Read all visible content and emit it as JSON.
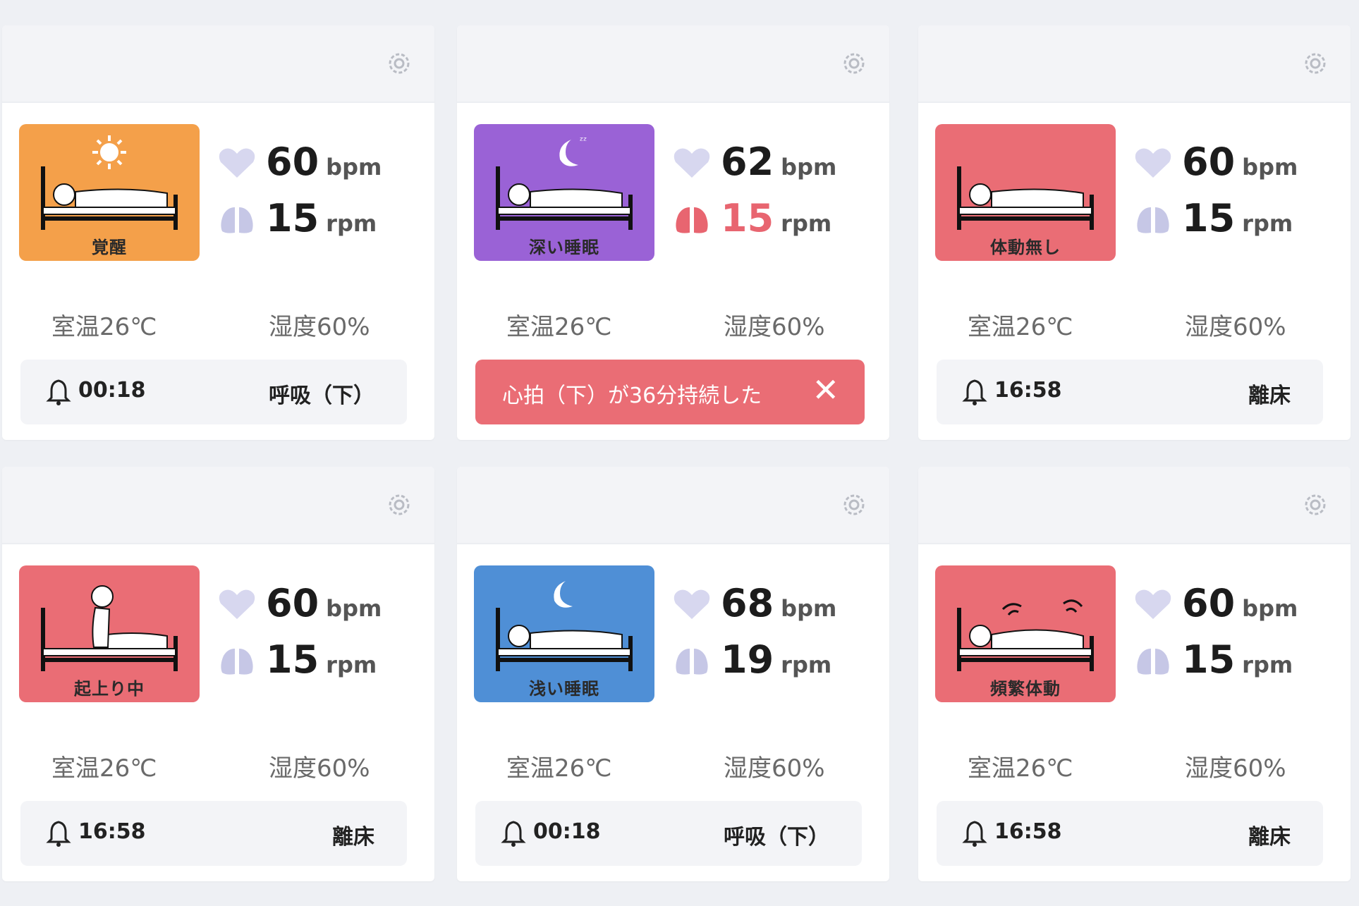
{
  "colors": {
    "awake": "#f4a04a",
    "deep_sleep": "#9a62d6",
    "alert_red": "#ea6d75",
    "light_sleep": "#4f8fd6",
    "heart_icon": "#d7d7ef",
    "lung_icon": "#c6c7e6",
    "lung_alert": "#e86570"
  },
  "cards": [
    {
      "status_label": "覚醒",
      "status_color": "#f4a04a",
      "figure": "awake-sun",
      "heart_rate": "60",
      "heart_unit": "bpm",
      "resp_rate": "15",
      "resp_unit": "rpm",
      "resp_alert": false,
      "temp": "室温26℃",
      "humidity": "湿度60%",
      "footer": {
        "type": "log",
        "time": "00:18",
        "event": "呼吸（下）"
      }
    },
    {
      "status_label": "深い睡眠",
      "status_color": "#9a62d6",
      "figure": "deep-sleep-moon",
      "heart_rate": "62",
      "heart_unit": "bpm",
      "resp_rate": "15",
      "resp_unit": "rpm",
      "resp_alert": true,
      "temp": "室温26℃",
      "humidity": "湿度60%",
      "footer": {
        "type": "alert",
        "message": "心拍（下）が36分持続した",
        "close": "✕"
      }
    },
    {
      "status_label": "体動無し",
      "status_color": "#ea6d75",
      "figure": "no-movement",
      "heart_rate": "60",
      "heart_unit": "bpm",
      "resp_rate": "15",
      "resp_unit": "rpm",
      "resp_alert": false,
      "temp": "室温26℃",
      "humidity": "湿度60%",
      "footer": {
        "type": "log",
        "time": "16:58",
        "event": "離床"
      }
    },
    {
      "status_label": "起上り中",
      "status_color": "#ea6d75",
      "figure": "sitting-up",
      "heart_rate": "60",
      "heart_unit": "bpm",
      "resp_rate": "15",
      "resp_unit": "rpm",
      "resp_alert": false,
      "temp": "室温26℃",
      "humidity": "湿度60%",
      "footer": {
        "type": "log",
        "time": "16:58",
        "event": "離床"
      }
    },
    {
      "status_label": "浅い睡眠",
      "status_color": "#4f8fd6",
      "figure": "light-sleep-moon",
      "heart_rate": "68",
      "heart_unit": "bpm",
      "resp_rate": "19",
      "resp_unit": "rpm",
      "resp_alert": false,
      "temp": "室温26℃",
      "humidity": "湿度60%",
      "footer": {
        "type": "log",
        "time": "00:18",
        "event": "呼吸（下）"
      }
    },
    {
      "status_label": "頻繁体動",
      "status_color": "#ea6d75",
      "figure": "frequent-movement",
      "heart_rate": "60",
      "heart_unit": "bpm",
      "resp_rate": "15",
      "resp_unit": "rpm",
      "resp_alert": false,
      "temp": "室温26℃",
      "humidity": "湿度60%",
      "footer": {
        "type": "log",
        "time": "16:58",
        "event": "離床"
      }
    }
  ]
}
